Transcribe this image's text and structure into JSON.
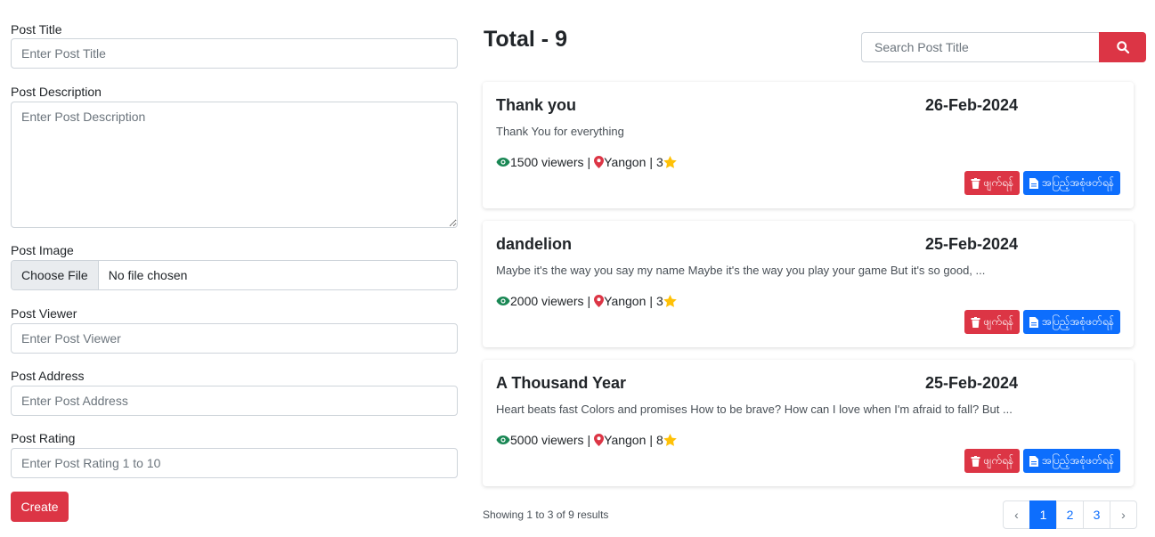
{
  "form": {
    "title_label": "Post Title",
    "title_placeholder": "Enter Post Title",
    "description_label": "Post Description",
    "description_placeholder": "Enter Post Description",
    "image_label": "Post Image",
    "choose_file_label": "Choose File",
    "no_file_text": "No file chosen",
    "viewer_label": "Post Viewer",
    "viewer_placeholder": "Enter Post Viewer",
    "address_label": "Post Address",
    "address_placeholder": "Enter Post Address",
    "rating_label": "Post Rating",
    "rating_placeholder": "Enter Post Rating 1 to 10",
    "create_label": "Create"
  },
  "header": {
    "total": "Total - 9",
    "search_placeholder": "Search Post Title",
    "search_icon": "search-icon"
  },
  "posts": [
    {
      "title": "Thank you",
      "date": "26-Feb-2024",
      "description": "Thank You for everything",
      "viewers": "1500 viewers",
      "location": "Yangon",
      "rating": "3",
      "delete_label": "ဖျက်ရန်",
      "details_label": "အပြည့်အစုံဖတ်ရန်"
    },
    {
      "title": "dandelion",
      "date": "25-Feb-2024",
      "description": "Maybe it's the way you say my name Maybe it's the way you play your game But it's so good, ...",
      "viewers": "2000 viewers",
      "location": "Yangon",
      "rating": "3",
      "delete_label": "ဖျက်ရန်",
      "details_label": "အပြည့်အစုံဖတ်ရန်"
    },
    {
      "title": "A Thousand Year",
      "date": "25-Feb-2024",
      "description": "Heart beats fast Colors and promises How to be brave? How can I love when I'm afraid to fall? But ...",
      "viewers": "5000 viewers",
      "location": "Yangon",
      "rating": "8",
      "delete_label": "ဖျက်ရန်",
      "details_label": "အပြည့်အစုံဖတ်ရန်"
    }
  ],
  "pagination": {
    "showing": "Showing 1 to 3 of 9 results",
    "prev": "‹",
    "pages": [
      "1",
      "2",
      "3"
    ],
    "next": "›",
    "active_page": "1"
  },
  "colors": {
    "danger": "#dc3545",
    "primary": "#0d6efd",
    "success": "#198754",
    "star": "#ffc107"
  }
}
